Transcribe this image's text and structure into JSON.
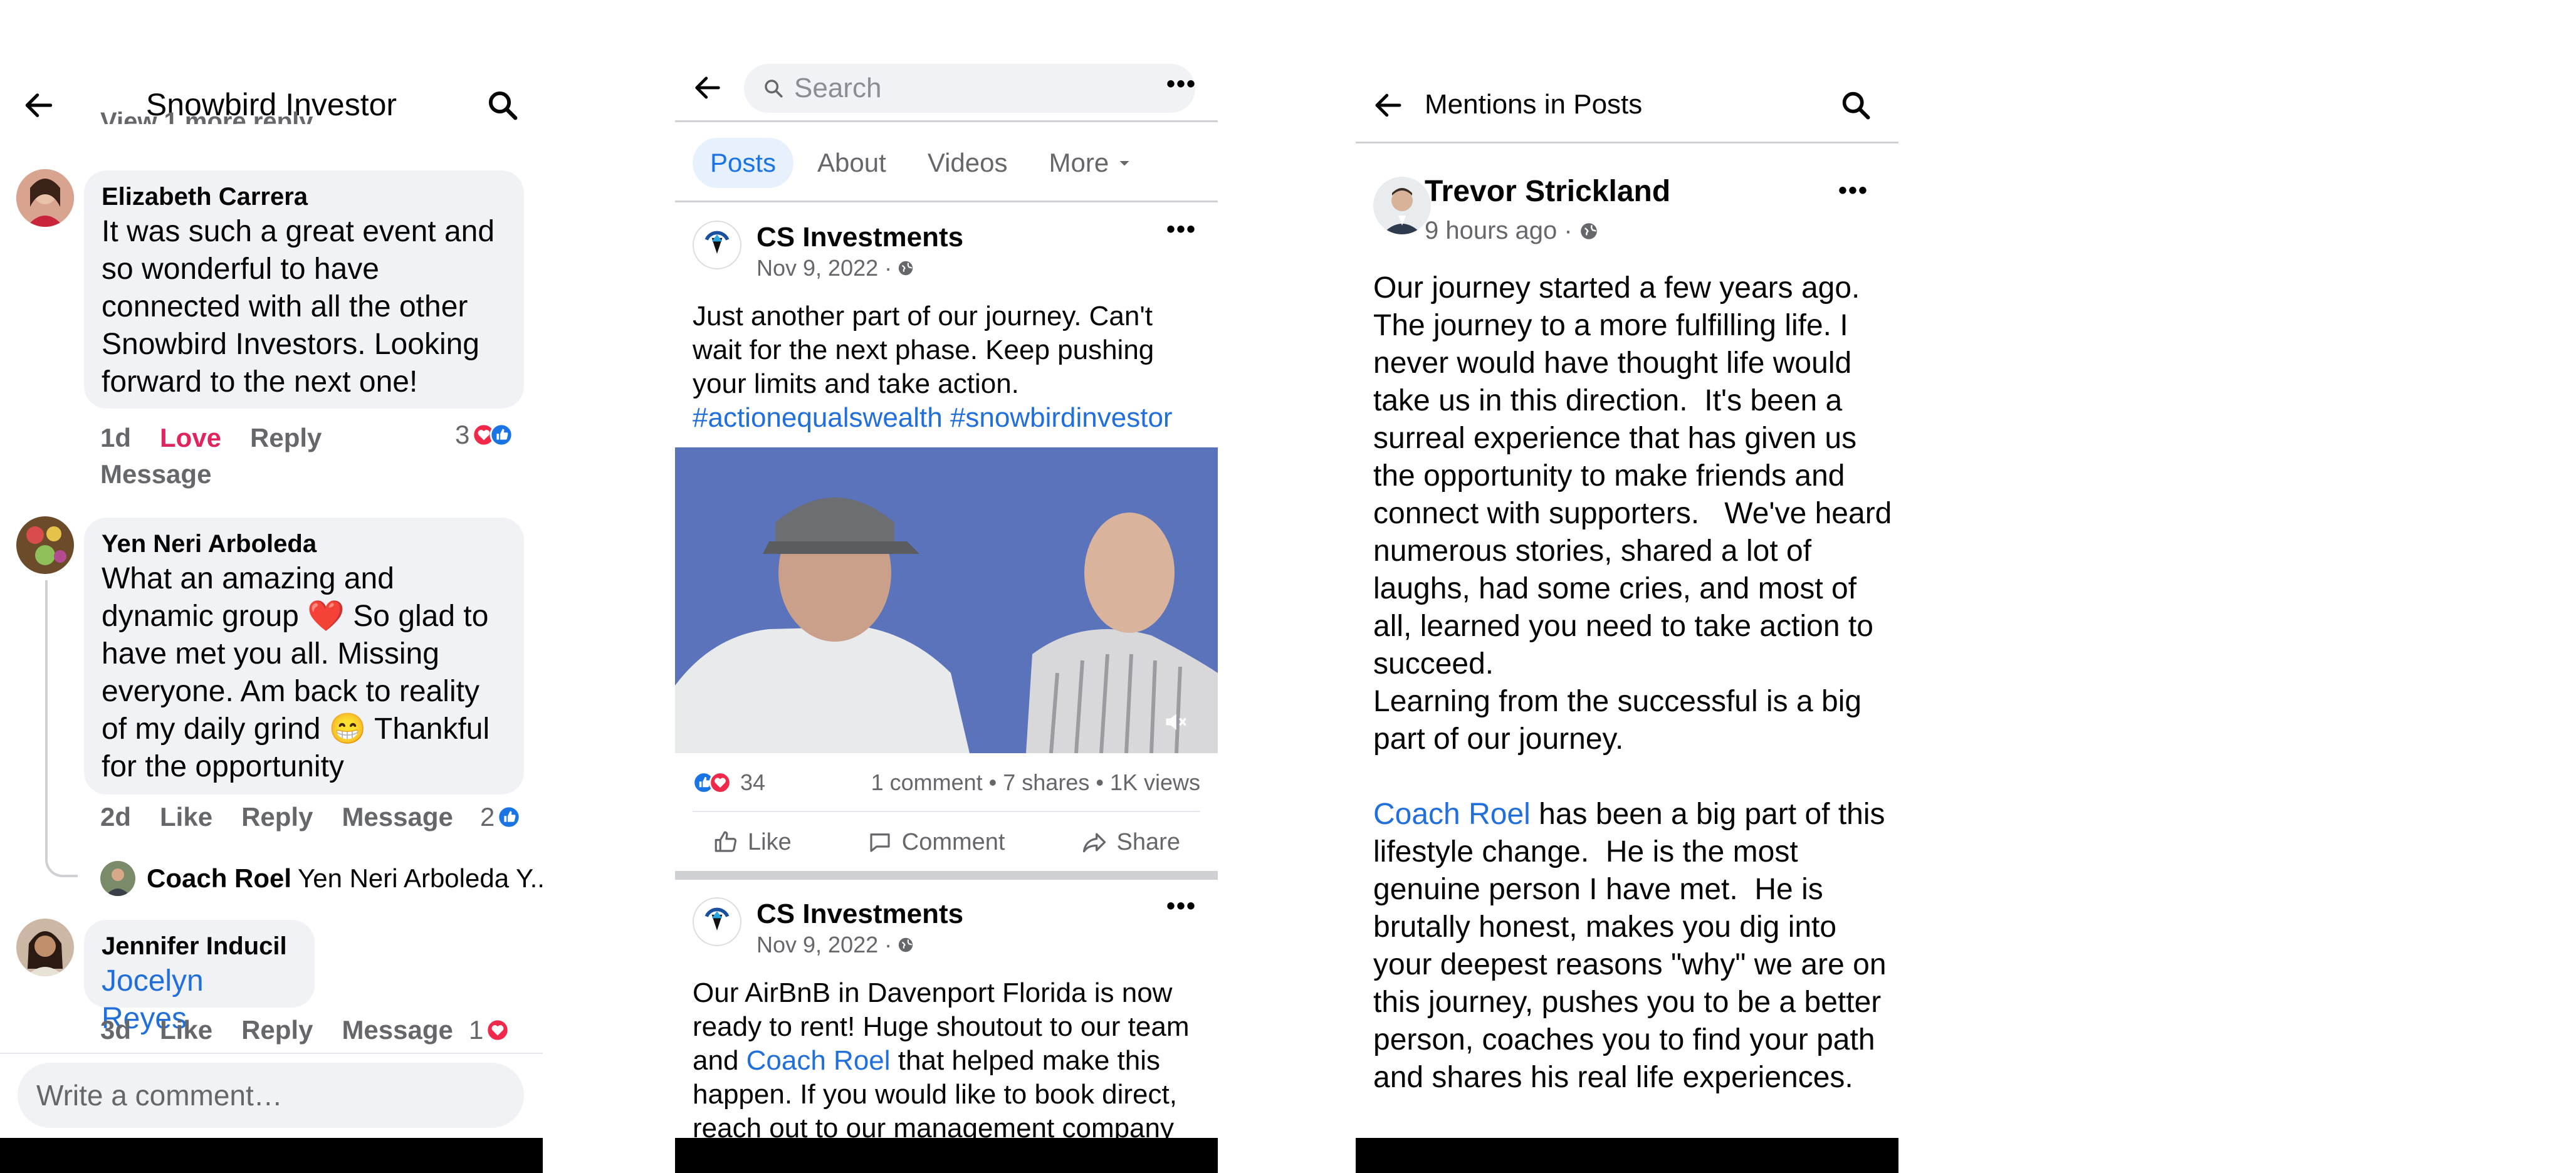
{
  "panel1": {
    "title": "Snowbird Investor",
    "cut_text": "View 1 more reply...",
    "comments": [
      {
        "name": "Elizabeth Carrera",
        "text": "It was such a great event and so wonderful to have connected with all the other Snowbird Investors.  Looking forward to the next one!",
        "time": "1d",
        "action1": "Love",
        "action2": "Reply",
        "action3": "Message",
        "reactions": "3"
      },
      {
        "name": "Yen Neri Arboleda",
        "text": "What an amazing and dynamic group ❤️ So glad to have met you all. Missing everyone. Am back to reality of my daily grind 😁 Thankful for  the opportunity",
        "time": "2d",
        "action1": "Like",
        "action2": "Reply",
        "action3": "Message",
        "reactions": "2"
      },
      {
        "name": "Jennifer Inducil",
        "text": "Jocelyn Reyes",
        "time": "3d",
        "action1": "Like",
        "action2": "Reply",
        "action3": "Message",
        "reactions": "1"
      }
    ],
    "reply_preview": {
      "name": "Coach Roel",
      "text": "Yen Neri Arboleda Y..."
    },
    "write_placeholder": "Write a comment…"
  },
  "panel2": {
    "search_placeholder": "Search",
    "tabs": [
      "Posts",
      "About",
      "Videos",
      "More"
    ],
    "post1": {
      "page_name": "CS Investments",
      "date": "Nov 9, 2022 ·",
      "text_main": "Just another part of our journey.  Can't wait for the next phase.  Keep pushing your limits and take action.",
      "hashtags": "#actionequalswealth #snowbirdinvestor",
      "reaction_count": "34",
      "stats": "1 comment • 7 shares • 1K views",
      "like": "Like",
      "comment": "Comment",
      "share": "Share"
    },
    "post2": {
      "page_name": "CS Investments",
      "date": "Nov 9, 2022 ·",
      "text_a": "Our AirBnB in Davenport Florida is now ready to rent!  Huge shoutout to our team and ",
      "mention": "Coach Roel",
      "text_b": " that helped make this happen.  If you would like to book direct, reach out to our management company"
    }
  },
  "panel3": {
    "title": "Mentions in Posts",
    "author": "Trevor Strickland",
    "time": "9 hours ago ·",
    "body_a": "Our journey started a few years ago. The journey to a more fulfilling life. I never would have thought life would take us in this direction.  It's been a surreal experience that has given us the opportunity to make friends and connect with supporters.   We've heard numerous stories, shared a lot of laughs, had some cries, and most of all, learned you need to take action to succeed.\nLearning from the successful is a big part of our journey.\n\n",
    "mention": "Coach Roel",
    "body_b": " has been a big part of this lifestyle change.  He is the most genuine person I have met.  He is brutally honest, makes you dig into your deepest reasons \"why\" we are on this journey, pushes you to be a better person, coaches you to find your path and shares his real life experiences."
  },
  "colors": {
    "link": "#216fdb",
    "love": "#e0245e",
    "like_blue": "#1b74e4",
    "bubble": "#f0f2f5"
  }
}
